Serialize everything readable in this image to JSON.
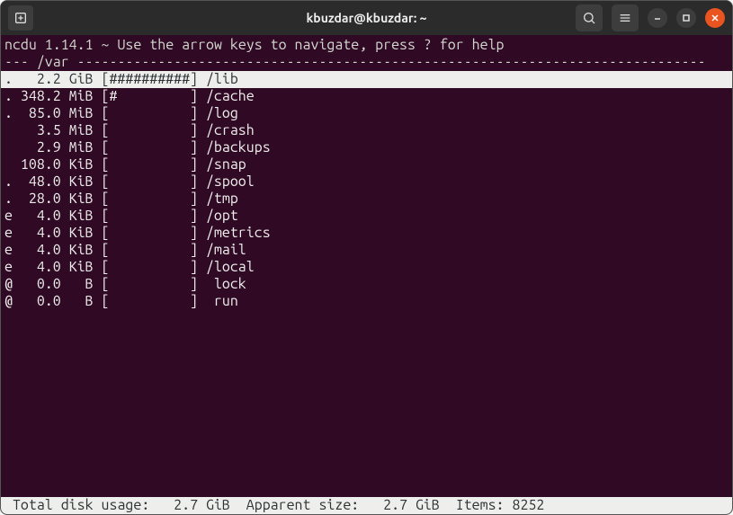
{
  "window": {
    "title": "kbuzdar@kbuzdar: ~"
  },
  "ncdu": {
    "header": "ncdu 1.14.1 ~ Use the arrow keys to navigate, press ? for help",
    "path_prefix": "--- ",
    "path": "/var",
    "path_fill": " ------------------------------------------------------------------------------",
    "rows": [
      {
        "mark": ".",
        "size": "2.2 GiB",
        "bar": "[##########]",
        "name": "/lib",
        "selected": true
      },
      {
        "mark": ".",
        "size": "348.2 MiB",
        "bar": "[#         ]",
        "name": "/cache",
        "selected": false
      },
      {
        "mark": ".",
        "size": "85.0 MiB",
        "bar": "[          ]",
        "name": "/log",
        "selected": false
      },
      {
        "mark": " ",
        "size": "3.5 MiB",
        "bar": "[          ]",
        "name": "/crash",
        "selected": false
      },
      {
        "mark": " ",
        "size": "2.9 MiB",
        "bar": "[          ]",
        "name": "/backups",
        "selected": false
      },
      {
        "mark": " ",
        "size": "108.0 KiB",
        "bar": "[          ]",
        "name": "/snap",
        "selected": false
      },
      {
        "mark": ".",
        "size": "48.0 KiB",
        "bar": "[          ]",
        "name": "/spool",
        "selected": false
      },
      {
        "mark": ".",
        "size": "28.0 KiB",
        "bar": "[          ]",
        "name": "/tmp",
        "selected": false
      },
      {
        "mark": "e",
        "size": "4.0 KiB",
        "bar": "[          ]",
        "name": "/opt",
        "selected": false
      },
      {
        "mark": "e",
        "size": "4.0 KiB",
        "bar": "[          ]",
        "name": "/metrics",
        "selected": false
      },
      {
        "mark": "e",
        "size": "4.0 KiB",
        "bar": "[          ]",
        "name": "/mail",
        "selected": false
      },
      {
        "mark": "e",
        "size": "4.0 KiB",
        "bar": "[          ]",
        "name": "/local",
        "selected": false
      },
      {
        "mark": "@",
        "size": "0.0   B",
        "bar": "[          ]",
        "name": " lock",
        "selected": false
      },
      {
        "mark": "@",
        "size": "0.0   B",
        "bar": "[          ]",
        "name": " run",
        "selected": false
      }
    ],
    "footer": " Total disk usage:   2.7 GiB  Apparent size:   2.7 GiB  Items: 8252"
  }
}
